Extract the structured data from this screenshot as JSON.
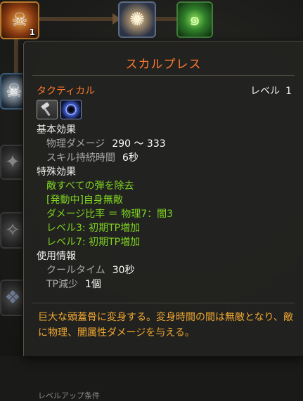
{
  "skill_tree": {
    "selected_node_level": "1"
  },
  "tooltip": {
    "title": "スカルプレス",
    "category": "タクティカル",
    "level_label": "レベル",
    "level_value": "1",
    "weapon_icons": [
      "hammer-icon",
      "dark-orb-icon"
    ],
    "basic_effect": {
      "header": "基本効果",
      "physical_damage_label": "物理ダメージ",
      "physical_damage_value": "290 ～ 333",
      "duration_label": "スキル持続時間",
      "duration_value": "6秒"
    },
    "special_effect": {
      "header": "特殊効果",
      "lines": [
        "敵すべての弾を除去",
        "[発動中]自身無敵",
        "ダメージ比率 ＝ 物理7：闇3",
        "レベル3: 初期TP増加",
        "レベル7: 初期TP増加"
      ]
    },
    "usage_info": {
      "header": "使用情報",
      "cooldown_label": "クールタイム",
      "cooldown_value": "30秒",
      "tp_label": "TP減少",
      "tp_value": "1個"
    },
    "description": "巨大な頭蓋骨に変身する。変身時間の間は無敵となり、敵に物理、闇属性ダメージを与える。",
    "next_section_partial": "レベルアップ条件"
  },
  "colors": {
    "title_orange": "#ff7a2f",
    "effect_green": "#7ed321",
    "description_gold": "#f0a830"
  }
}
